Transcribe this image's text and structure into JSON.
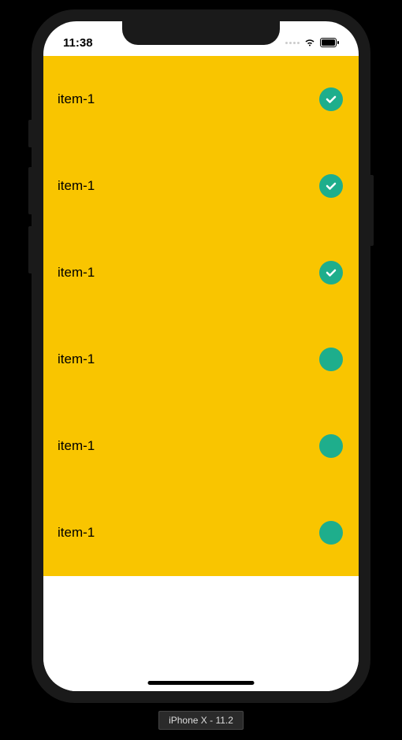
{
  "status_bar": {
    "time": "11:38"
  },
  "colors": {
    "list_background": "#F9C500",
    "check_circle": "#1EAE8C"
  },
  "list": {
    "items": [
      {
        "label": "item-1",
        "checked": true
      },
      {
        "label": "item-1",
        "checked": true
      },
      {
        "label": "item-1",
        "checked": true
      },
      {
        "label": "item-1",
        "checked": false
      },
      {
        "label": "item-1",
        "checked": false
      },
      {
        "label": "item-1",
        "checked": false
      }
    ]
  },
  "device_label": "iPhone X - 11.2"
}
